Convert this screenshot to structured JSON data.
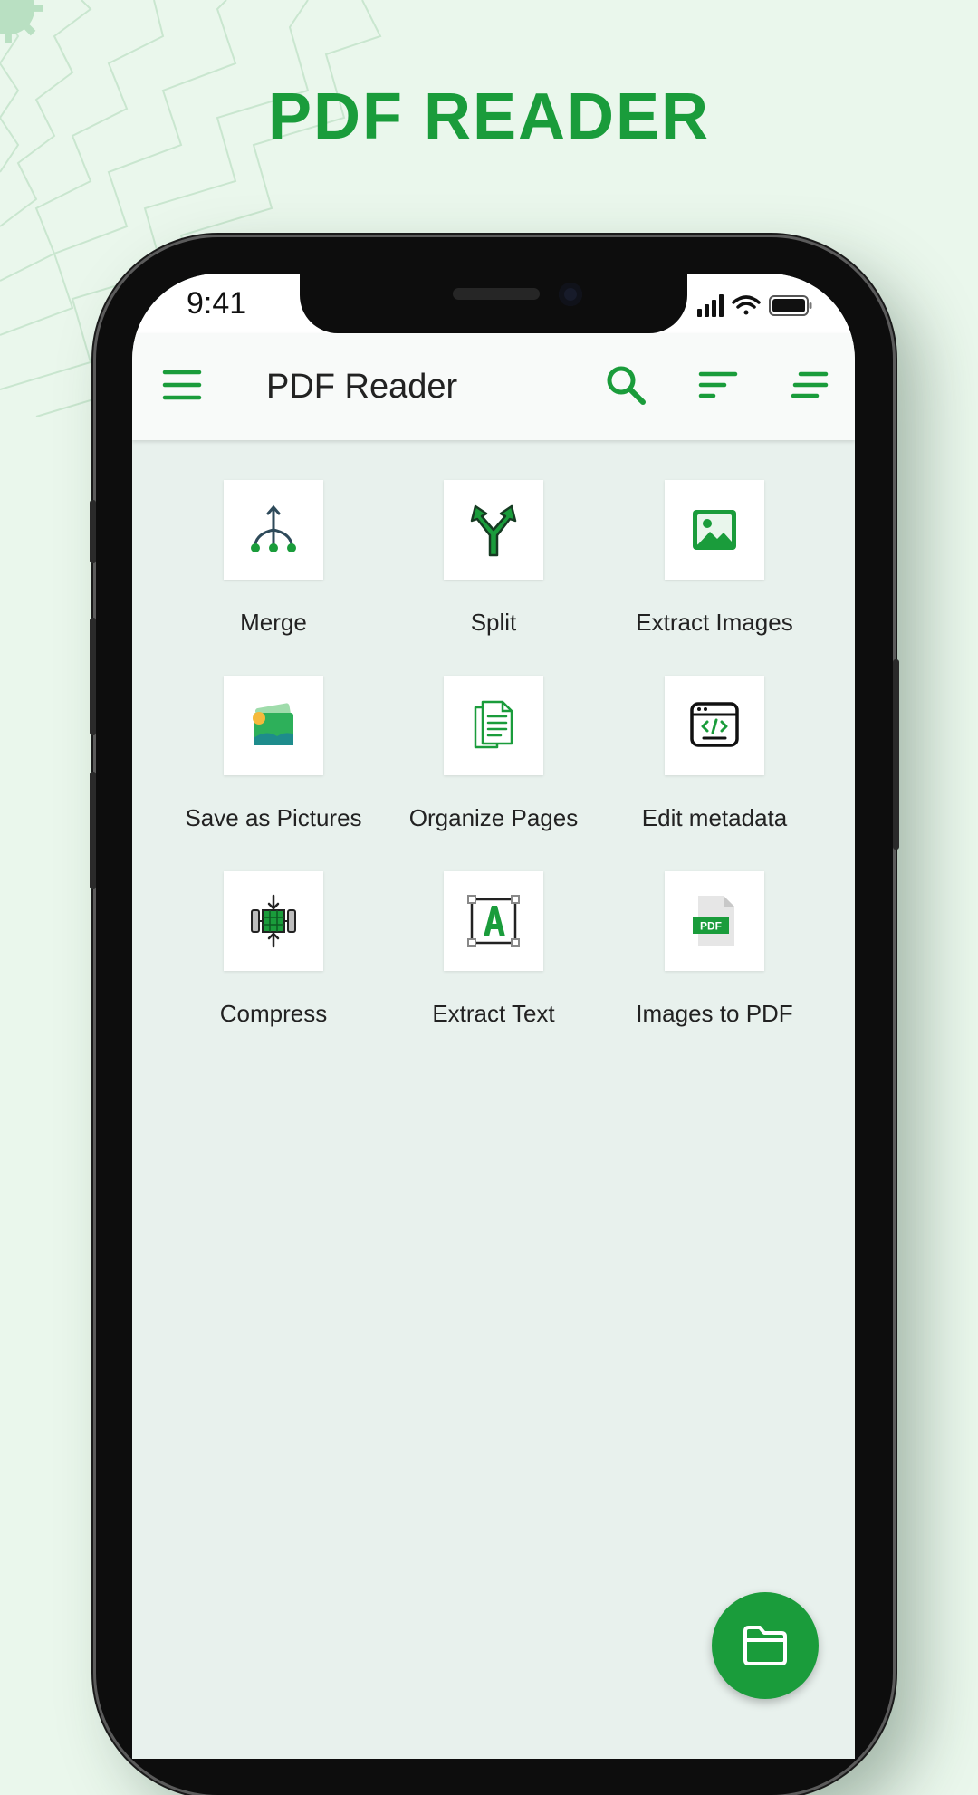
{
  "headline": "PDF READER",
  "status_bar": {
    "time": "9:41",
    "icons": [
      "signal-icon",
      "wifi-icon",
      "battery-icon"
    ]
  },
  "app_bar": {
    "title": "PDF Reader",
    "icons": [
      "menu-icon",
      "search-icon",
      "sort-icon",
      "filter-icon"
    ]
  },
  "tools": [
    {
      "label": "Merge",
      "icon": "merge-icon"
    },
    {
      "label": "Split",
      "icon": "split-icon"
    },
    {
      "label": "Extract Images",
      "icon": "image-icon"
    },
    {
      "label": "Save as Pictures",
      "icon": "pictures-icon"
    },
    {
      "label": "Organize Pages",
      "icon": "pages-icon"
    },
    {
      "label": "Edit metadata",
      "icon": "code-window-icon"
    },
    {
      "label": "Compress",
      "icon": "compress-icon"
    },
    {
      "label": "Extract Text",
      "icon": "text-select-icon"
    },
    {
      "label": "Images to PDF",
      "icon": "pdf-file-icon"
    }
  ],
  "fab": {
    "icon": "folder-icon"
  },
  "colors": {
    "accent": "#1a9c3b",
    "background": "#eaf7ec",
    "screen_background": "#e8f1ed"
  }
}
